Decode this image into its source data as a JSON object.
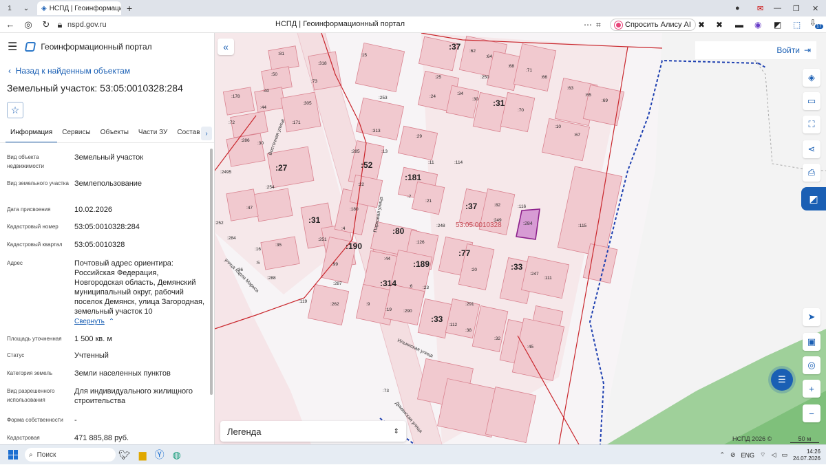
{
  "browser": {
    "tab_counter": "1",
    "tab_title": "НСПД | Геоинформацио",
    "url": "nspd.gov.ru",
    "page_title": "НСПД | Геоинформационный портал",
    "alisa_label": "Спросить Алису AI",
    "more_dots": "⋯",
    "ext_badge": "17"
  },
  "panel": {
    "app_title": "Геоинформационный портал",
    "back_label": "Назад к найденным объектам",
    "parcel_title": "Земельный участок: 53:05:0010328:284",
    "tabs": [
      "Информация",
      "Сервисы",
      "Объекты",
      "Части ЗУ",
      "Состав"
    ],
    "collapse_label": "Свернуть",
    "rows": [
      {
        "key": "Вид объекта недвижимости",
        "value": "Земельный участок"
      },
      {
        "key": "Вид земельного участка",
        "value": "Землепользование"
      },
      {
        "key": "Дата присвоения",
        "value": "10.02.2026"
      },
      {
        "key": "Кадастровый номер",
        "value": "53:05:0010328:284"
      },
      {
        "key": "Кадастровый квартал",
        "value": "53:05:0010328"
      },
      {
        "key": "Адрес",
        "value": "Почтовый адрес ориентира: Российская Федерация, Новгородская область, Демянский муниципальный округ, рабочий поселок Демянск, улица Загородная, земельный участок 10"
      },
      {
        "key": "Площадь уточненная",
        "value": "1 500 кв. м"
      },
      {
        "key": "Статус",
        "value": "Учтенный"
      },
      {
        "key": "Категория земель",
        "value": "Земли населенных пунктов"
      },
      {
        "key": "Вид разрешенного использования",
        "value": "Для индивидуального жилищного строительства"
      },
      {
        "key": "Форма собственности",
        "value": "-"
      },
      {
        "key": "Кадастровая",
        "value": "471 885,88 руб."
      }
    ]
  },
  "map": {
    "login_label": "Войти",
    "legend_label": "Легенда",
    "copyright": "НСПД 2026 ©",
    "scale_label": "50 м",
    "quarter_label": "53:05:0010328",
    "selected_label": ":284",
    "streets": [
      "Восточная улица",
      "Парковая улица",
      "Ильинская улица",
      "улица Карла Маркса",
      "Демянская улица"
    ],
    "labels": [
      ":81",
      ":318",
      ":15",
      ":50",
      ":73",
      ":37",
      ":62",
      ":64",
      ":178",
      ":40",
      ":305",
      ":25",
      ":250",
      ":68",
      ":71",
      ":66",
      ":44",
      ":171",
      ":253",
      ":24",
      ":34",
      ":30",
      ":31",
      ":70",
      ":63",
      ":65",
      ":69",
      ":72",
      ":30",
      ":313",
      ":10",
      ":67",
      ":286",
      ":29",
      ":285",
      ":13",
      ":2495",
      ":27",
      ":52",
      ":11",
      ":114",
      ":254",
      ":181",
      ":22",
      ":7",
      ":21",
      ":47",
      ":37",
      ":82",
      ":116",
      ":252",
      ":31",
      ":180",
      ":4",
      ":248",
      ":249",
      ":115",
      ":284",
      ":251",
      ":80",
      ":126",
      ":16",
      ":35",
      ":190",
      ":77",
      ":5",
      ":44",
      ":189",
      ":20",
      ":36",
      ":99",
      ":33",
      ":247",
      ":111",
      ":288",
      ":287",
      ":314",
      ":6",
      ":23",
      ":119",
      ":262",
      ":9",
      ":19",
      ":290",
      ":291",
      ":33",
      ":112",
      ":38",
      ":32",
      ":45",
      ":73",
      ":110",
      ":1"
    ]
  },
  "taskbar": {
    "search_placeholder": "Поиск",
    "lang": "ENG",
    "time": "14:26",
    "date": "24.07.2026"
  }
}
